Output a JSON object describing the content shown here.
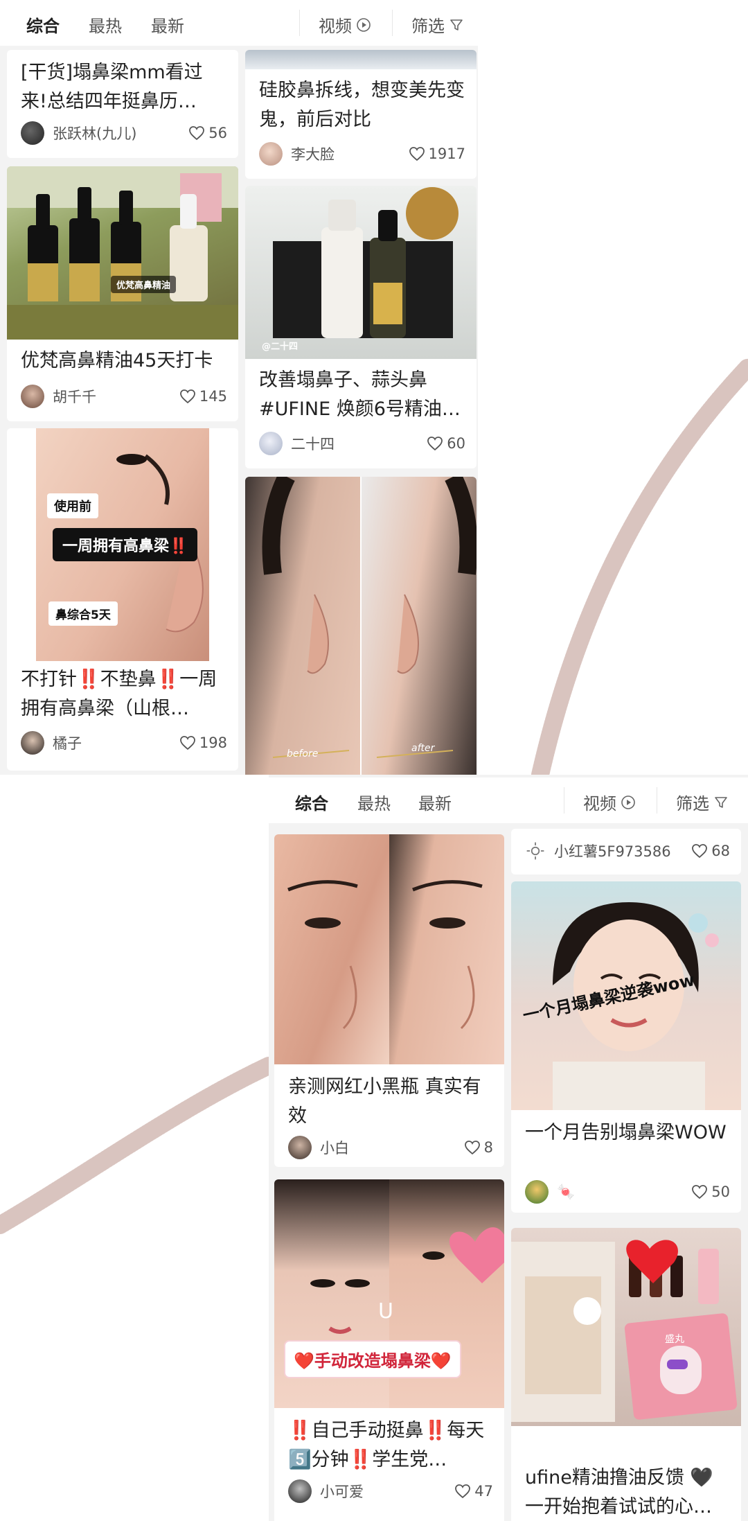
{
  "top_tabs": {
    "tabs": [
      "综合",
      "最热",
      "最新"
    ],
    "video": "视频",
    "filter": "筛选"
  },
  "bottom_tabs": {
    "tabs": [
      "综合",
      "最热",
      "最新"
    ],
    "video": "视频",
    "filter": "筛选"
  },
  "cards_top": [
    {
      "title": "[干货]塌鼻梁mm看过来!总结四年挺鼻历…",
      "author": "张跃林(九儿)",
      "likes": "56"
    },
    {
      "title": "硅胶鼻拆线，想变美先变鬼，前后对比",
      "author": "李大脸",
      "likes": "1917"
    },
    {
      "title": "优梵高鼻精油45天打卡",
      "author": "胡千千",
      "likes": "145",
      "image_label": "优梵高鼻精油"
    },
    {
      "title": "改善塌鼻子、蒜头鼻 #UFINE 焕颜6号精油…",
      "author": "二十四",
      "likes": "60",
      "image_label": "@二十四"
    },
    {
      "title": "不打针‼️不垫鼻‼️一周拥有高鼻梁（山根…",
      "author": "橘子",
      "likes": "198",
      "image_tags": [
        "使用前",
        "一周拥有高鼻梁‼️",
        "鼻综合5天"
      ]
    },
    {
      "image_labels": [
        "before",
        "after"
      ]
    }
  ],
  "cards_bottom": [
    {
      "author": "小红薯5F973586",
      "likes": "68"
    },
    {
      "title": "亲测网红小黑瓶 真实有效",
      "author": "小白",
      "likes": "8"
    },
    {
      "title": "一个月告别塌鼻梁WOW",
      "author": "🍬",
      "likes": "50",
      "image_caption": "一个月塌鼻梁逆袭wow"
    },
    {
      "title": "‼️自己手动挺鼻‼️每天5️⃣分钟‼️学生党…",
      "author": "小可爱",
      "likes": "47",
      "image_banner": "❤️手动改造塌鼻梁❤️"
    },
    {
      "title": "ufine精油撸油反馈 🖤一开始抱着试试的心…",
      "image_label": "盛丸"
    }
  ],
  "colors": {
    "accent": "#ff2442",
    "text": "#222222",
    "muted": "#555555",
    "bg": "#f3f3f3"
  }
}
